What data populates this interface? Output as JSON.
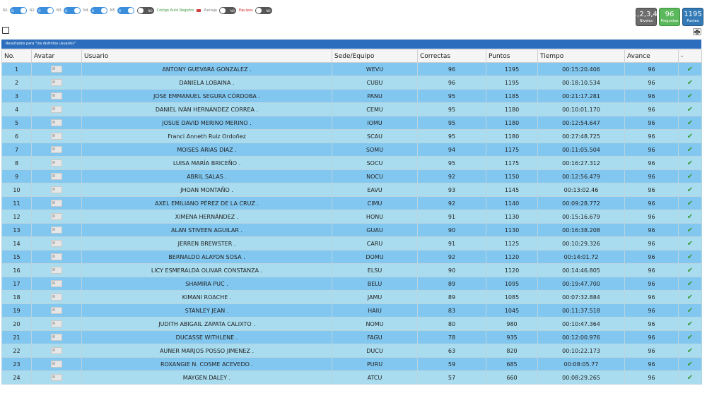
{
  "toolbar": {
    "toggles": [
      {
        "label": "N1",
        "state": "SI"
      },
      {
        "label": "N2",
        "state": "SI"
      },
      {
        "label": "N3",
        "state": "SI"
      },
      {
        "label": "N4",
        "state": "SI"
      },
      {
        "label": "N5",
        "state": "SI"
      },
      {
        "label": "",
        "state": "NO"
      }
    ],
    "codigo_label": "Código Auto Registro",
    "puntaje_label": "Puntaje",
    "puntaje_state": "NO",
    "equipos_label": "Equipos",
    "equipos_state": "NO"
  },
  "badges": {
    "niveles": {
      "value": "1,2,3,4,",
      "label": "Niveles"
    },
    "preguntas": {
      "value": "96",
      "label": "Preguntas"
    },
    "punteo": {
      "value": "1195",
      "label": "Punteo"
    }
  },
  "results_title": "Resultados para \"los distintos usuarios\"",
  "table": {
    "columns": [
      "No.",
      "Avatar",
      "Usuario",
      "Sede/Equipo",
      "Correctas",
      "Puntos",
      "Tiempo",
      "Avance",
      "-"
    ],
    "rows": [
      {
        "no": "1",
        "usuario": "ANTONY GUEVARA GONZALEZ .",
        "sede": "WEVU",
        "correctas": "96",
        "puntos": "1195",
        "tiempo": "00:15:20.406",
        "avance": "96"
      },
      {
        "no": "2",
        "usuario": "DANIELA LOBAINA .",
        "sede": "CUBU",
        "correctas": "96",
        "puntos": "1195",
        "tiempo": "00:18:10.534",
        "avance": "96"
      },
      {
        "no": "3",
        "usuario": "JOSE EMMANUEL SEGURA CÓRDOBA .",
        "sede": "PANU",
        "correctas": "95",
        "puntos": "1185",
        "tiempo": "00:21:17.281",
        "avance": "96"
      },
      {
        "no": "4",
        "usuario": "DANIEL IVÁN HERNÁNDEZ CORREA .",
        "sede": "CEMU",
        "correctas": "95",
        "puntos": "1180",
        "tiempo": "00:10:01.170",
        "avance": "96"
      },
      {
        "no": "5",
        "usuario": "JOSUE DAVID MERINO MERINO .",
        "sede": "IOMU",
        "correctas": "95",
        "puntos": "1180",
        "tiempo": "00:12:54.647",
        "avance": "96"
      },
      {
        "no": "6",
        "usuario": "Franci Anneth Ruiz Ordoñez",
        "sede": "SCAU",
        "correctas": "95",
        "puntos": "1180",
        "tiempo": "00:27:48.725",
        "avance": "96"
      },
      {
        "no": "7",
        "usuario": "MOISES ARIAS DIAZ .",
        "sede": "SOMU",
        "correctas": "94",
        "puntos": "1175",
        "tiempo": "00:11:05.504",
        "avance": "96"
      },
      {
        "no": "8",
        "usuario": "LUISA MARÍA BRICEÑO .",
        "sede": "SOCU",
        "correctas": "95",
        "puntos": "1175",
        "tiempo": "00:16:27.312",
        "avance": "96"
      },
      {
        "no": "9",
        "usuario": "ABRIL SALAS .",
        "sede": "NOCU",
        "correctas": "92",
        "puntos": "1150",
        "tiempo": "00:12:56.479",
        "avance": "96"
      },
      {
        "no": "10",
        "usuario": "JHOAN MONTAÑO .",
        "sede": "EAVU",
        "correctas": "93",
        "puntos": "1145",
        "tiempo": "00:13:02.46",
        "avance": "96"
      },
      {
        "no": "11",
        "usuario": "AXEL EMILIANO PÉREZ DE LA CRUZ .",
        "sede": "CIMU",
        "correctas": "92",
        "puntos": "1140",
        "tiempo": "00:09:28.772",
        "avance": "96"
      },
      {
        "no": "12",
        "usuario": "XIMENA HERNÁNDEZ .",
        "sede": "HONU",
        "correctas": "91",
        "puntos": "1130",
        "tiempo": "00:15:16.679",
        "avance": "96"
      },
      {
        "no": "13",
        "usuario": "ALAN STIVEEN AGUILAR .",
        "sede": "GUAU",
        "correctas": "90",
        "puntos": "1130",
        "tiempo": "00:16:38.208",
        "avance": "96"
      },
      {
        "no": "14",
        "usuario": "JERREN BREWSTER .",
        "sede": "CARU",
        "correctas": "91",
        "puntos": "1125",
        "tiempo": "00:10:29.326",
        "avance": "96"
      },
      {
        "no": "15",
        "usuario": "BERNALDO ALAYON SOSA .",
        "sede": "DOMU",
        "correctas": "92",
        "puntos": "1120",
        "tiempo": "00:14:01.72",
        "avance": "96"
      },
      {
        "no": "16",
        "usuario": "LICY ESMERALDA OLIVAR CONSTANZA .",
        "sede": "ELSU",
        "correctas": "90",
        "puntos": "1120",
        "tiempo": "00:14:46.805",
        "avance": "96"
      },
      {
        "no": "17",
        "usuario": "SHAMIRA PUC .",
        "sede": "BELU",
        "correctas": "89",
        "puntos": "1095",
        "tiempo": "00:19:47.700",
        "avance": "96"
      },
      {
        "no": "18",
        "usuario": "KIMANI ROACHE .",
        "sede": "JAMU",
        "correctas": "89",
        "puntos": "1085",
        "tiempo": "00:07:32.884",
        "avance": "96"
      },
      {
        "no": "19",
        "usuario": "STANLEY JEAN .",
        "sede": "HAIU",
        "correctas": "83",
        "puntos": "1045",
        "tiempo": "00:11:37.518",
        "avance": "96"
      },
      {
        "no": "20",
        "usuario": "JUDITH ABIGAIL ZAPATA CALIXTO .",
        "sede": "NOMU",
        "correctas": "80",
        "puntos": "980",
        "tiempo": "00:10:47.364",
        "avance": "96"
      },
      {
        "no": "21",
        "usuario": "DUCASSE WITHLENE .",
        "sede": "FAGU",
        "correctas": "78",
        "puntos": "935",
        "tiempo": "00:12:00.976",
        "avance": "96"
      },
      {
        "no": "22",
        "usuario": "AUNER MARJOS POSSO JIMENEZ .",
        "sede": "DUCU",
        "correctas": "63",
        "puntos": "820",
        "tiempo": "00:10:22.173",
        "avance": "96"
      },
      {
        "no": "23",
        "usuario": "ROXANGIE N. COSME ACEVEDO .",
        "sede": "PURU",
        "correctas": "59",
        "puntos": "685",
        "tiempo": "00:08:05.77",
        "avance": "96"
      },
      {
        "no": "24",
        "usuario": "MAYGEN DALEY .",
        "sede": "ATCU",
        "correctas": "57",
        "puntos": "660",
        "tiempo": "00:08:29.265",
        "avance": "96"
      }
    ]
  },
  "colors": {
    "row_even": "#82c7f0",
    "row_odd": "#a9dcef",
    "header_bar": "#2c6ebd",
    "check": "#3c9a3c"
  }
}
